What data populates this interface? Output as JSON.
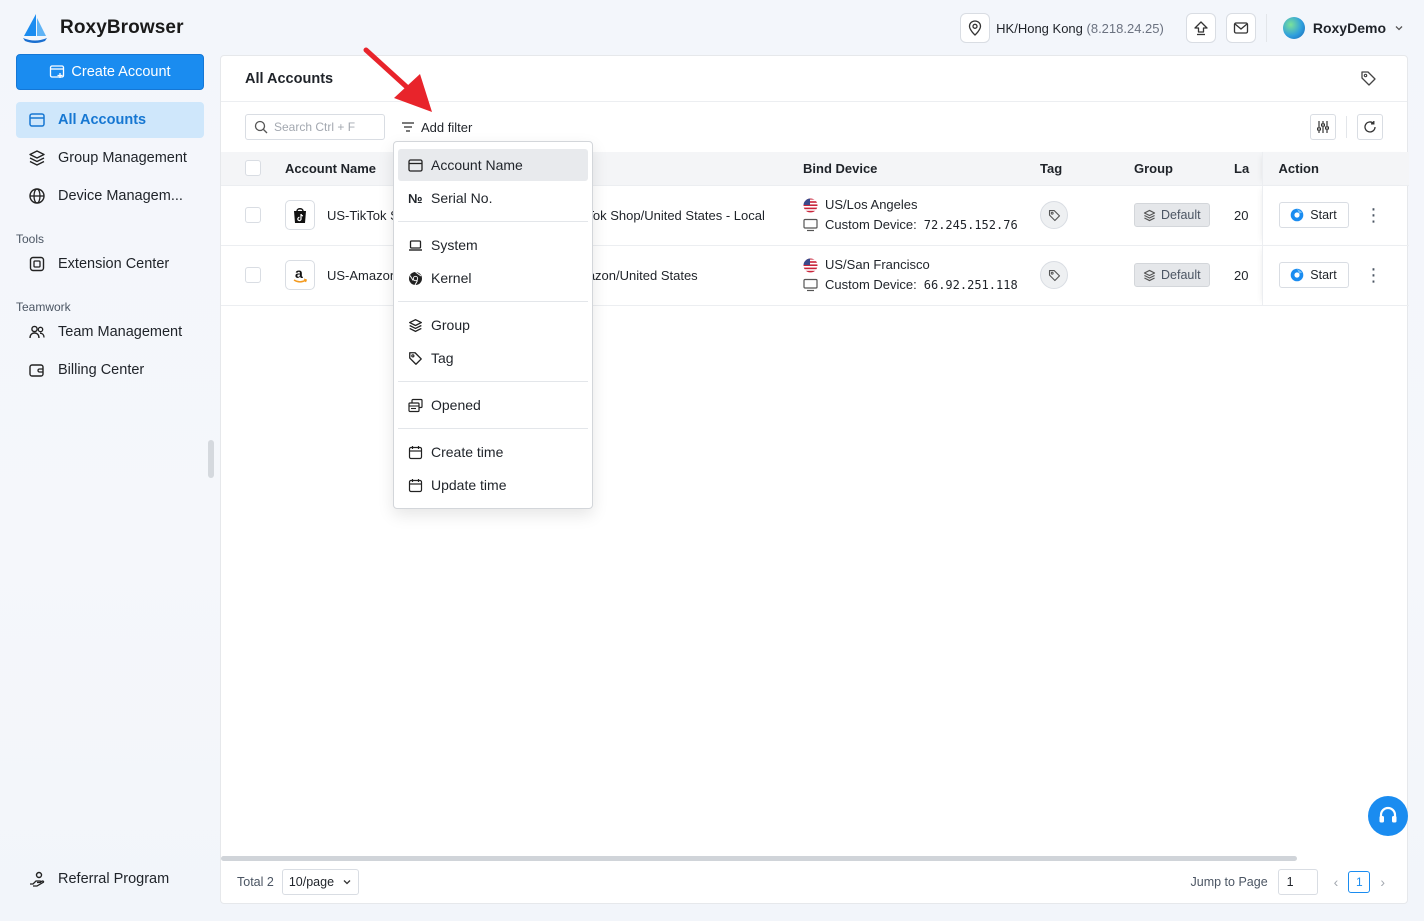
{
  "brand": {
    "name": "RoxyBrowser"
  },
  "topbar": {
    "location": "HK/Hong Kong",
    "ip": "(8.218.24.25)",
    "user_name": "RoxyDemo"
  },
  "sidebar": {
    "create_label": "Create Account",
    "items": [
      {
        "label": "All Accounts"
      },
      {
        "label": "Group Management"
      },
      {
        "label": "Device Managem..."
      }
    ],
    "tools_title": "Tools",
    "tools_items": [
      {
        "label": "Extension Center"
      }
    ],
    "teamwork_title": "Teamwork",
    "teamwork_items": [
      {
        "label": "Team Management"
      },
      {
        "label": "Billing Center"
      }
    ],
    "referral_label": "Referral Program"
  },
  "main": {
    "title": "All Accounts",
    "search_placeholder": "Search Ctrl + F",
    "add_filter_label": "Add filter",
    "columns": {
      "account_name": "Account Name",
      "bind_device": "Bind Device",
      "tag": "Tag",
      "group": "Group",
      "last": "La",
      "action": "Action"
    },
    "rows": [
      {
        "name": "US-TikTok S",
        "platform": "ikTok Shop/United States - Local",
        "location": "US/Los Angeles",
        "device_label": "Custom Device:",
        "device_ip": "72.245.152.76",
        "group": "Default",
        "last": "20",
        "start": "Start"
      },
      {
        "name": "US-Amazon",
        "platform": "mazon/United States",
        "location": "US/San Francisco",
        "device_label": "Custom Device:",
        "device_ip": "66.92.251.118",
        "group": "Default",
        "last": "20",
        "start": "Start"
      }
    ],
    "footer": {
      "total": "Total 2",
      "page_size": "10/page",
      "jump_label": "Jump to Page",
      "jump_value": "1",
      "current_page": "1"
    }
  },
  "filter_menu": {
    "items": [
      {
        "label": "Account Name",
        "icon": "window-icon"
      },
      {
        "label": "Serial No.",
        "icon": "numero-icon"
      },
      {
        "label": "System",
        "icon": "laptop-icon"
      },
      {
        "label": "Kernel",
        "icon": "chrome-icon"
      },
      {
        "label": "Group",
        "icon": "layers-icon"
      },
      {
        "label": "Tag",
        "icon": "tag-icon"
      },
      {
        "label": "Opened",
        "icon": "opened-windows-icon"
      },
      {
        "label": "Create time",
        "icon": "calendar-icon"
      },
      {
        "label": "Update time",
        "icon": "calendar-icon"
      }
    ]
  },
  "colors": {
    "accent": "#1a8cf0",
    "active_bg": "#cfe7fb",
    "arrow": "#e8242b"
  }
}
